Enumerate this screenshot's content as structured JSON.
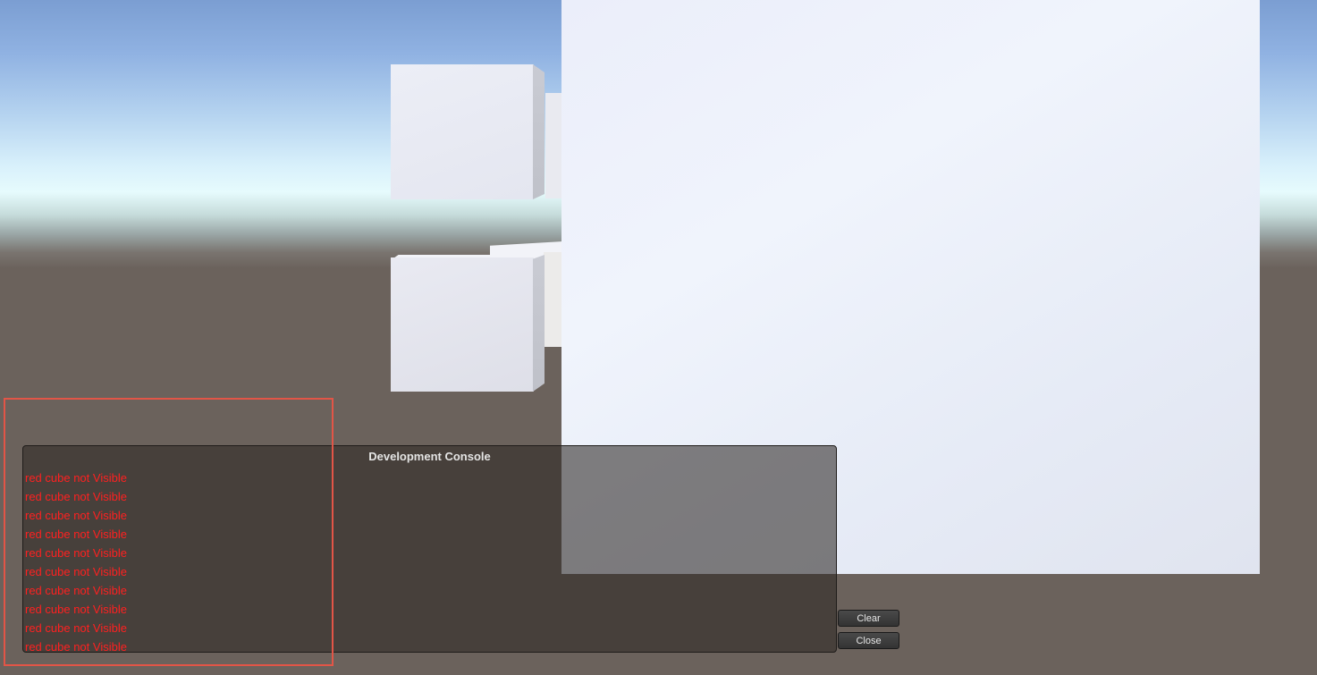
{
  "console": {
    "title": "Development Console",
    "log_color": "#ff2020",
    "log": [
      "red cube not Visible",
      "red cube not Visible",
      "red cube not Visible",
      "red cube not Visible",
      "red cube not Visible",
      "red cube not Visible",
      "red cube not Visible",
      "red cube not Visible",
      "red cube not Visible",
      "red cube not Visible"
    ],
    "clear_label": "Clear",
    "close_label": "Close"
  },
  "colors": {
    "ground": "#6b625c",
    "highlight": "#e25547"
  }
}
